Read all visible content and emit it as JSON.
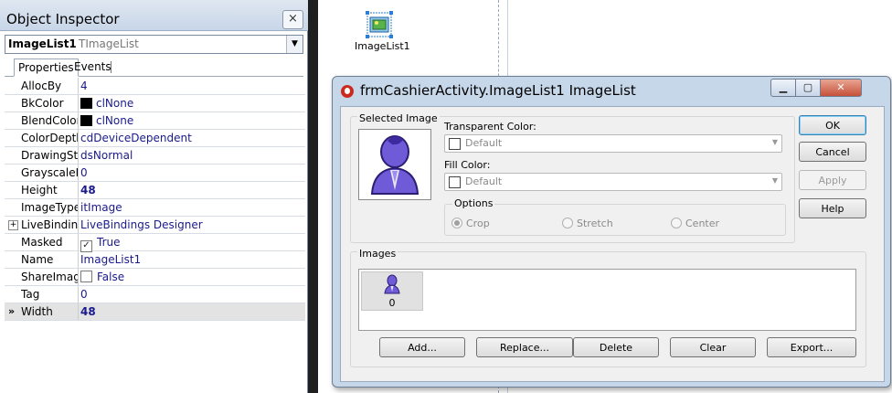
{
  "object_inspector": {
    "title": "Object Inspector",
    "close_glyph": "×",
    "component_name": "ImageList1",
    "component_type": "TImageList",
    "tabs": [
      "Properties",
      "Events"
    ],
    "properties": [
      {
        "name": "AllocBy",
        "value": "4"
      },
      {
        "name": "BkColor",
        "value": "clNone"
      },
      {
        "name": "BlendColor",
        "value": "clNone"
      },
      {
        "name": "ColorDepth",
        "value": "cdDeviceDependent"
      },
      {
        "name": "DrawingSty",
        "value": "dsNormal"
      },
      {
        "name": "GrayscaleFa",
        "value": "0"
      },
      {
        "name": "Height",
        "value": "48"
      },
      {
        "name": "ImageType",
        "value": "itImage"
      },
      {
        "name": "LiveBinding",
        "value": "LiveBindings Designer"
      },
      {
        "name": "Masked",
        "value": "True"
      },
      {
        "name": "Name",
        "value": "ImageList1"
      },
      {
        "name": "ShareImage",
        "value": "False"
      },
      {
        "name": "Tag",
        "value": "0"
      },
      {
        "name": "Width",
        "value": "48"
      }
    ]
  },
  "designer": {
    "component_caption": "ImageList1"
  },
  "dialog": {
    "title": "frmCashierActivity.ImageList1 ImageList",
    "selected_image_label": "Selected Image",
    "transparent_color_label": "Transparent Color:",
    "transparent_color_value": "Default",
    "fill_color_label": "Fill Color:",
    "fill_color_value": "Default",
    "options_label": "Options",
    "options": [
      "Crop",
      "Stretch",
      "Center"
    ],
    "images_label": "Images",
    "image_items": [
      {
        "index": "0"
      }
    ],
    "buttons": {
      "ok": "OK",
      "cancel": "Cancel",
      "apply": "Apply",
      "help": "Help",
      "add": "Add...",
      "replace": "Replace...",
      "delete": "Delete",
      "clear": "Clear",
      "export": "Export..."
    }
  },
  "colors": {
    "value_text": "#1a1a8c",
    "dialog_frame": "#c7d7ea",
    "avatar": "#6f5ad8"
  }
}
